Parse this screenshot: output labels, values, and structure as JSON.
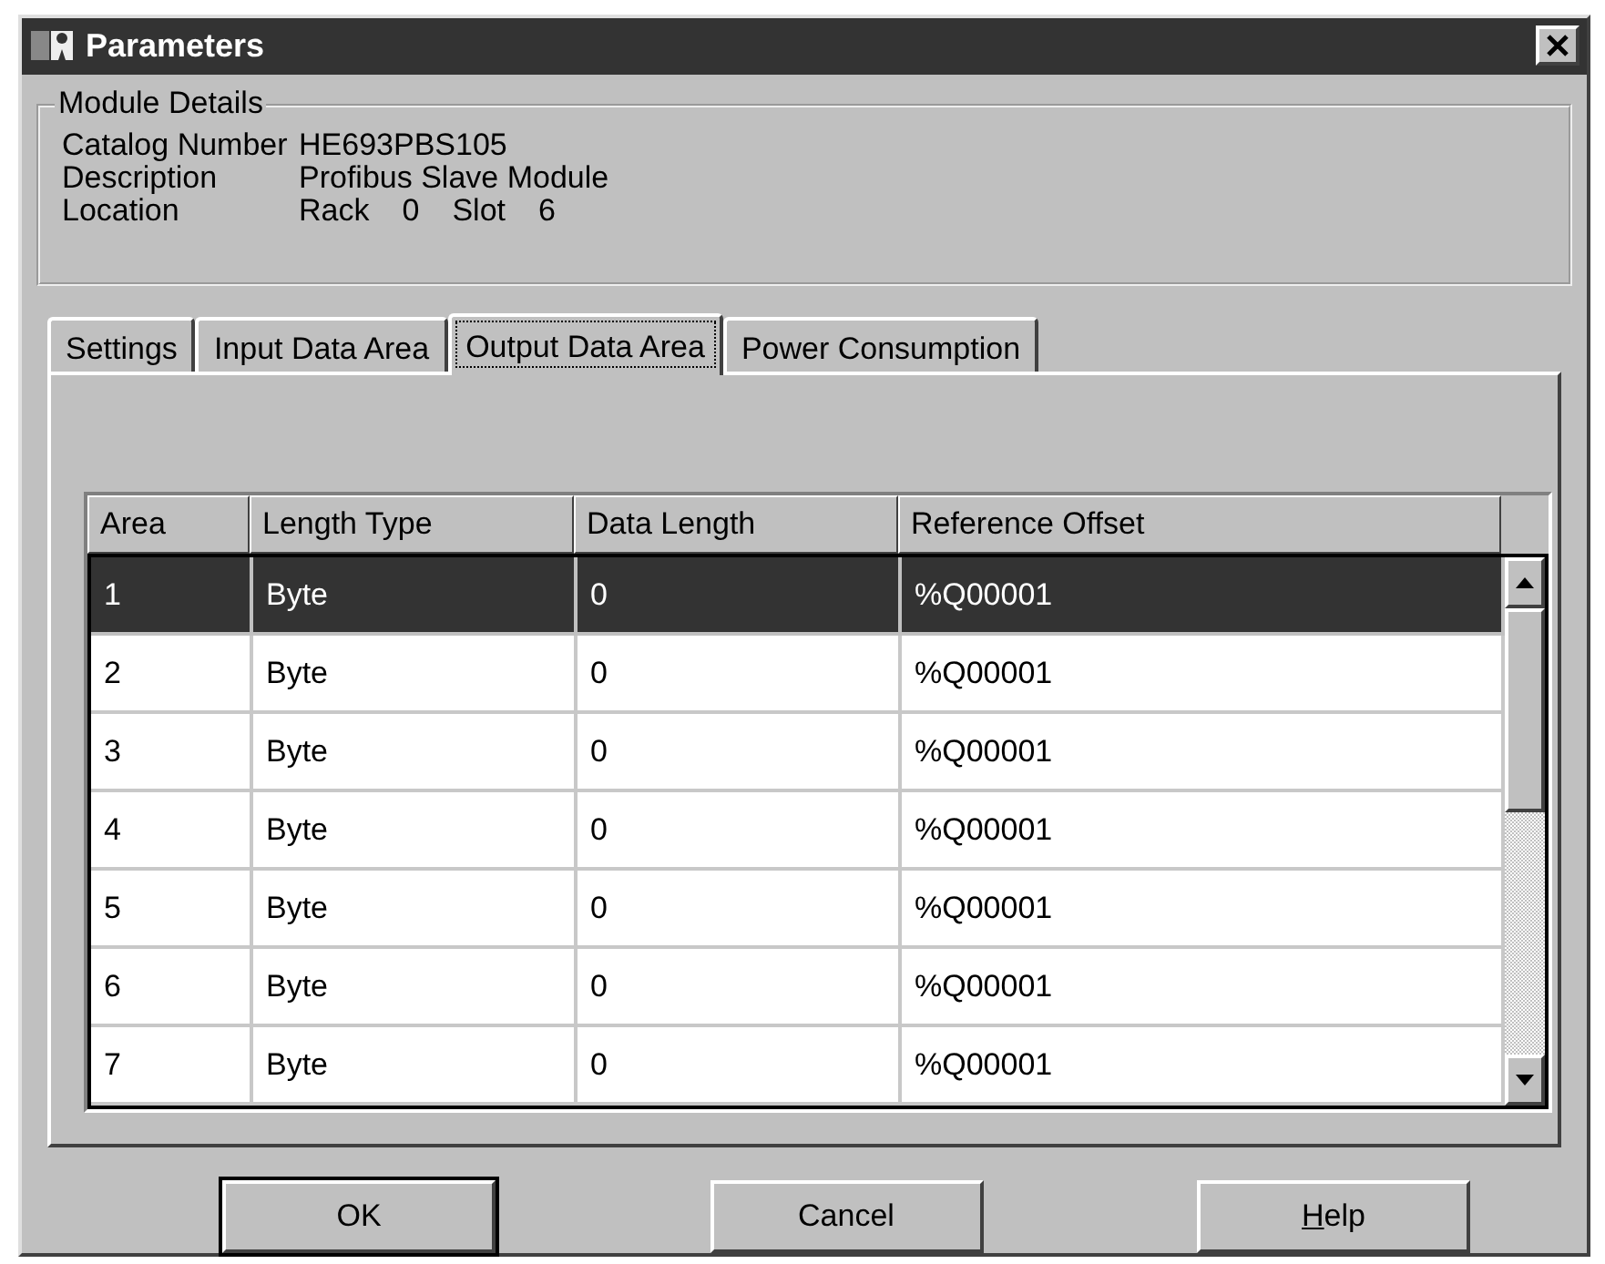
{
  "window": {
    "title": "Parameters"
  },
  "module_details": {
    "title": "Module Details",
    "catalog_label": "Catalog Number",
    "catalog_value": "HE693PBS105",
    "description_label": "Description",
    "description_value": "Profibus Slave Module",
    "location_label": "Location",
    "rack_label": "Rack",
    "rack_value": "0",
    "slot_label": "Slot",
    "slot_value": "6"
  },
  "tabs": [
    {
      "label": "Settings",
      "selected": false
    },
    {
      "label": "Input Data Area",
      "selected": false
    },
    {
      "label": "Output Data Area",
      "selected": true
    },
    {
      "label": "Power Consumption",
      "selected": false
    }
  ],
  "table": {
    "columns": [
      "Area",
      "Length Type",
      "Data Length",
      "Reference Offset"
    ],
    "rows": [
      {
        "cells": [
          "1",
          "Byte",
          "0",
          "%Q00001"
        ],
        "selected": true
      },
      {
        "cells": [
          "2",
          "Byte",
          "0",
          "%Q00001"
        ],
        "selected": false
      },
      {
        "cells": [
          "3",
          "Byte",
          "0",
          "%Q00001"
        ],
        "selected": false
      },
      {
        "cells": [
          "4",
          "Byte",
          "0",
          "%Q00001"
        ],
        "selected": false
      },
      {
        "cells": [
          "5",
          "Byte",
          "0",
          "%Q00001"
        ],
        "selected": false
      },
      {
        "cells": [
          "6",
          "Byte",
          "0",
          "%Q00001"
        ],
        "selected": false
      },
      {
        "cells": [
          "7",
          "Byte",
          "0",
          "%Q00001"
        ],
        "selected": false
      }
    ]
  },
  "buttons": [
    {
      "label": "OK",
      "default": true
    },
    {
      "label": "Cancel",
      "default": false
    },
    {
      "label": "Help",
      "default": false,
      "mnemonic": true
    }
  ]
}
